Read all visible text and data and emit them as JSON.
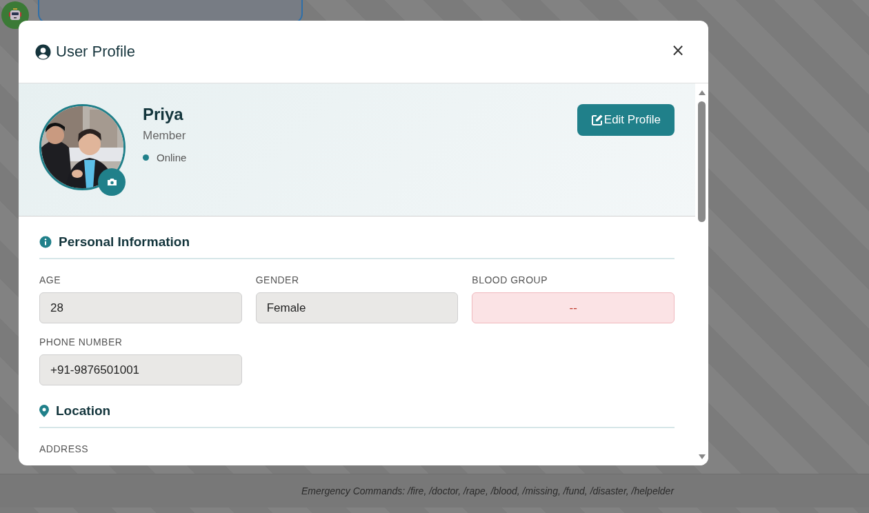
{
  "background": {
    "command_hint": "Emergency Commands: /fire, /doctor, /rape, /blood, /missing, /fund, /disaster, /helpelder"
  },
  "modal": {
    "title": "User Profile",
    "close": "×"
  },
  "profile": {
    "name": "Priya",
    "role": "Member",
    "status": "Online",
    "online": true,
    "edit_button": "Edit Profile"
  },
  "sections": [
    {
      "kind": "info",
      "title": "Personal Information",
      "fields": [
        {
          "label": "AGE",
          "value": "28",
          "kind": "plain"
        },
        {
          "label": "GENDER",
          "value": "Female",
          "kind": "plain"
        },
        {
          "label": "BLOOD GROUP",
          "value": "--",
          "kind": "alert"
        },
        {
          "label": "PHONE NUMBER",
          "value": "+91-9876501001",
          "kind": "plain"
        }
      ]
    },
    {
      "kind": "location",
      "title": "Location",
      "fields": [
        {
          "label": "ADDRESS"
        }
      ]
    }
  ]
}
